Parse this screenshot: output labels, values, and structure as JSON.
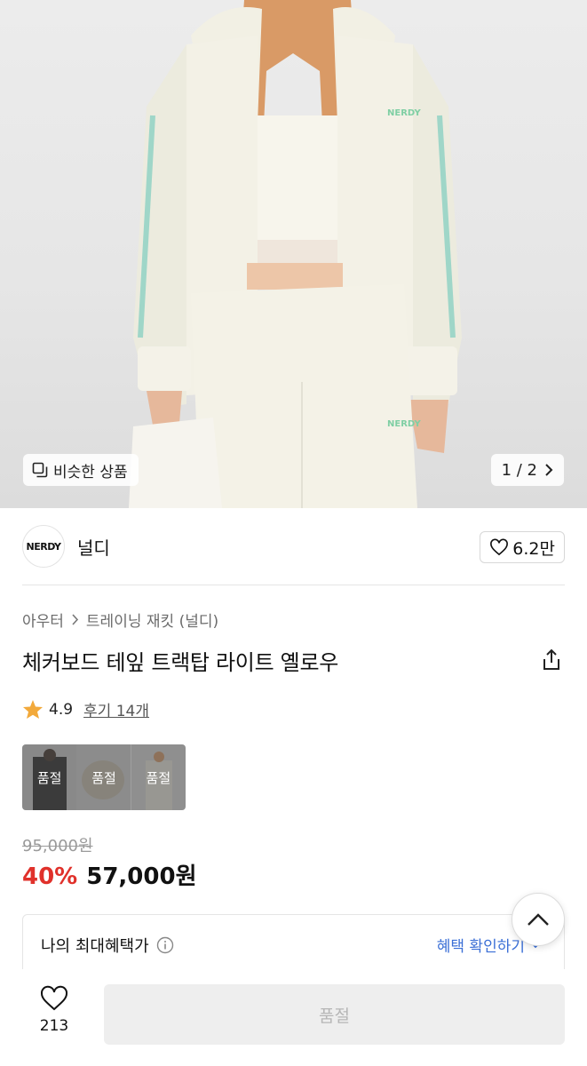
{
  "hero": {
    "similar_label": "비슷한 상품",
    "pager": "1 / 2"
  },
  "brand": {
    "logo_text": "NERDY",
    "name": "널디",
    "like_count": "6.2만"
  },
  "breadcrumb": [
    "아우터",
    "트레이닝 재킷 (널디)"
  ],
  "product": {
    "title": "체커보드 테잎 트랙탑 라이트 옐로우",
    "rating": "4.9",
    "review_link": "후기 14개"
  },
  "options": [
    {
      "label": "품절"
    },
    {
      "label": "품절"
    },
    {
      "label": "품절"
    }
  ],
  "price": {
    "original": "95,000원",
    "discount": "40%",
    "sale": "57,000원"
  },
  "benefits": {
    "label": "나의 최대혜택가",
    "link": "혜택 확인하기"
  },
  "bottom": {
    "like_count": "213",
    "buy_label": "품절"
  },
  "colors": {
    "discount": "#e0312b",
    "link": "#3b6fd6",
    "star": "#f2a93b"
  }
}
